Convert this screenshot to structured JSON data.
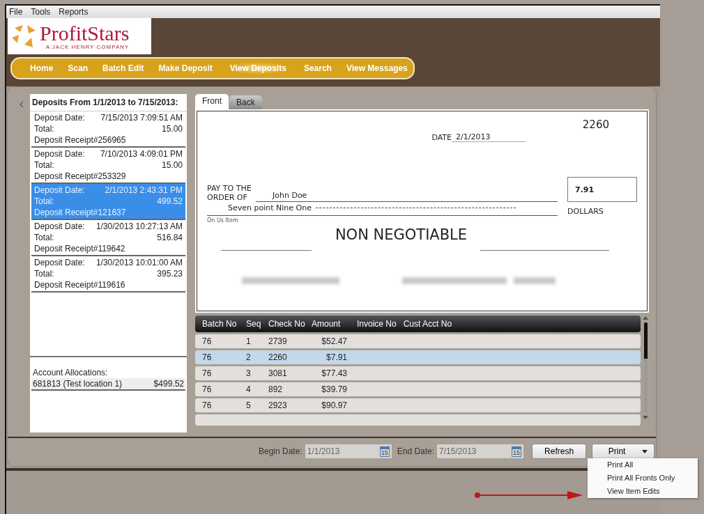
{
  "menu": [
    {
      "label": "File"
    },
    {
      "label": "Tools"
    },
    {
      "label": "Reports"
    }
  ],
  "logo": {
    "name": "ProfitStars",
    "tagline": "A JACK HENRY COMPANY"
  },
  "nav": [
    {
      "label": "Home",
      "selected": false
    },
    {
      "label": "Scan",
      "selected": false
    },
    {
      "label": "Batch Edit",
      "selected": false
    },
    {
      "label": "Make Deposit",
      "selected": false
    },
    {
      "label": "View Deposits",
      "selected": true
    },
    {
      "label": "Search",
      "selected": false
    },
    {
      "label": "View Messages",
      "selected": false
    }
  ],
  "deposits": {
    "title": "Deposits From 1/1/2013 to 7/15/2013:",
    "items": [
      {
        "date_label": "Deposit Date:",
        "date": "7/15/2013 7:09:51 AM",
        "total_label": "Total:",
        "total": "15.00",
        "receipt": "Deposit Receipt#256965",
        "selected": false
      },
      {
        "date_label": "Deposit Date:",
        "date": "7/10/2013 4:09:01 PM",
        "total_label": "Total:",
        "total": "15.00",
        "receipt": "Deposit Receipt#253329",
        "selected": false
      },
      {
        "date_label": "Deposit Date:",
        "date": "2/1/2013 2:43:31 PM",
        "total_label": "Total:",
        "total": "499.52",
        "receipt": "Deposit Receipt#121637",
        "selected": true
      },
      {
        "date_label": "Deposit Date:",
        "date": "1/30/2013 10:27:13 AM",
        "total_label": "Total:",
        "total": "516.84",
        "receipt": "Deposit Receipt#119642",
        "selected": false
      },
      {
        "date_label": "Deposit Date:",
        "date": "1/30/2013 10:01:00 AM",
        "total_label": "Total:",
        "total": "395.23",
        "receipt": "Deposit Receipt#119616",
        "selected": false
      }
    ]
  },
  "allocations": {
    "title": "Account Allocations:",
    "items": [
      {
        "account": "681813 (Test location 1)",
        "amount": "$499.52"
      }
    ]
  },
  "tabs": [
    {
      "label": "Front",
      "selected": true
    },
    {
      "label": "Back",
      "selected": false
    }
  ],
  "check": {
    "number": "2260",
    "date_label": "DATE",
    "date": "2/1/2013",
    "payto_label": "PAY TO THE ORDER OF",
    "payee": "John Doe",
    "amount": "7.91",
    "written_amount": "Seven point Nine One",
    "dollars_label": "DOLLARS",
    "on_us": "On Us Item",
    "stamp": "NON NEGOTIABLE"
  },
  "table": {
    "columns": [
      "Batch No",
      "Seq",
      "Check No",
      "Amount",
      "Invoice No",
      "Cust Acct No"
    ],
    "rows": [
      {
        "cells": [
          "76",
          "1",
          "2739",
          "$52.47"
        ],
        "selected": false
      },
      {
        "cells": [
          "76",
          "2",
          "2260",
          "$7.91"
        ],
        "selected": true
      },
      {
        "cells": [
          "76",
          "3",
          "3081",
          "$77.43"
        ],
        "selected": false
      },
      {
        "cells": [
          "76",
          "4",
          "892",
          "$39.79"
        ],
        "selected": false
      },
      {
        "cells": [
          "76",
          "5",
          "2923",
          "$90.97"
        ],
        "selected": false
      }
    ]
  },
  "footer": {
    "begin_label": "Begin Date:",
    "begin_date": "1/1/2013",
    "begin_day": "15",
    "end_label": "End Date:",
    "end_date": "7/15/2013",
    "end_day": "15",
    "refresh": "Refresh",
    "print": "Print"
  },
  "print_menu": {
    "items": [
      {
        "label": "Print All"
      },
      {
        "label": "Print All Fronts Only"
      },
      {
        "label": "View Item Edits"
      }
    ]
  }
}
